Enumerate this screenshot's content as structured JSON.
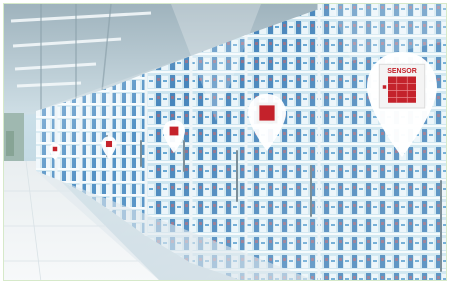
{
  "scene": {
    "subject": "supermarket-freezer-aisle",
    "colors": {
      "ice_blue": "#dbeef6",
      "sky_blue": "#bfe1ef",
      "pin_white": "#ffffff",
      "sensor_red": "#c4222b",
      "frame_green": "#d6e9c9"
    }
  },
  "pins": [
    {
      "name": "sensor-pin-1",
      "icon": "map-pin-icon",
      "label": ""
    },
    {
      "name": "sensor-pin-2",
      "icon": "map-pin-icon",
      "label": ""
    },
    {
      "name": "sensor-pin-3",
      "icon": "map-pin-icon",
      "label": ""
    },
    {
      "name": "sensor-pin-4",
      "icon": "map-pin-icon",
      "label": ""
    },
    {
      "name": "sensor-pin-5",
      "icon": "map-pin-icon",
      "label": "SENSOR"
    }
  ]
}
